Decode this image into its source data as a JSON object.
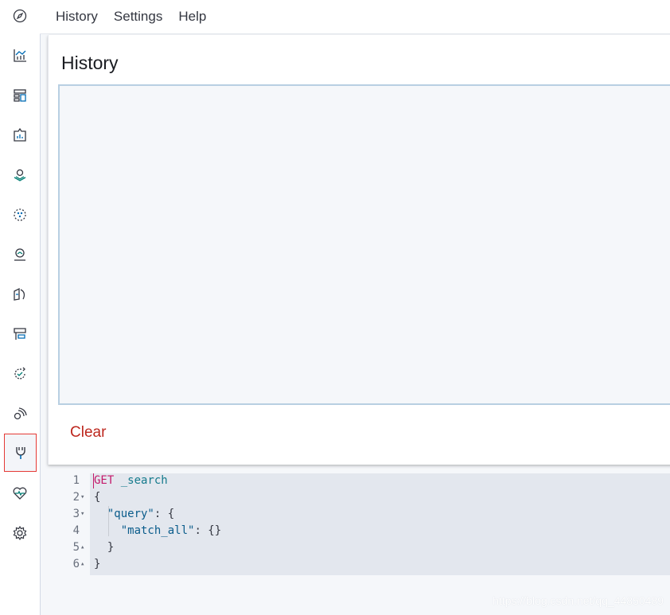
{
  "menu": {
    "items": [
      "History",
      "Settings",
      "Help"
    ]
  },
  "rail": {
    "icons": [
      "discover-icon",
      "visualize-icon",
      "dashboard-icon",
      "canvas-icon",
      "maps-icon",
      "ml-icon",
      "infrastructure-icon",
      "logs-icon",
      "apm-icon",
      "uptime-icon",
      "siem-icon",
      "dev-tools-icon",
      "monitoring-icon",
      "management-icon"
    ],
    "active": "dev-tools-icon",
    "accent": "#e53935"
  },
  "history": {
    "title": "History",
    "clear_label": "Clear"
  },
  "editor": {
    "lines": [
      {
        "n": "1",
        "fold": ""
      },
      {
        "n": "2",
        "fold": "▾"
      },
      {
        "n": "3",
        "fold": "▾"
      },
      {
        "n": "4",
        "fold": ""
      },
      {
        "n": "5",
        "fold": "▴"
      },
      {
        "n": "6",
        "fold": "▴"
      }
    ],
    "method": "GET",
    "endpoint": "_search",
    "query_key": "\"query\"",
    "match_all_key": "\"match_all\"",
    "line2": "{",
    "line3_tail": ": {",
    "line4_tail": ": {}",
    "line5": "}",
    "line6": "}"
  },
  "watermark": "https://blog.csdn.net/qq_44850489"
}
